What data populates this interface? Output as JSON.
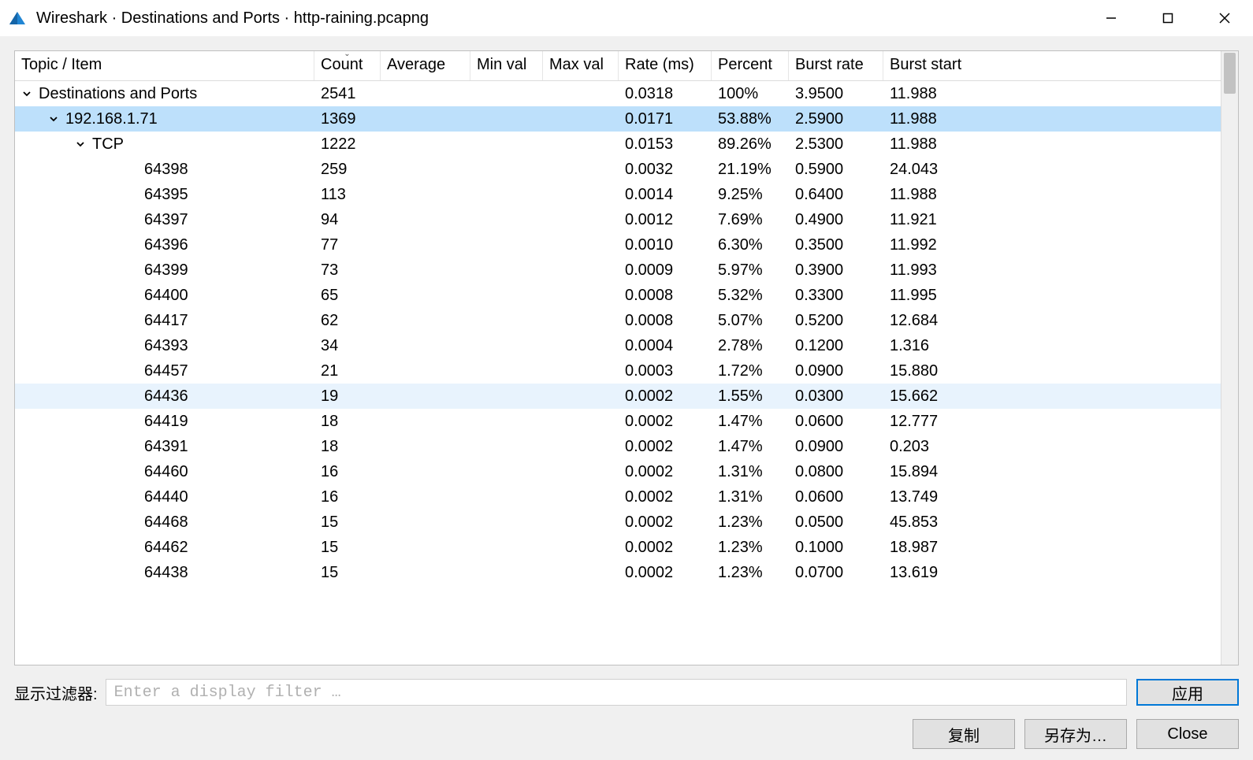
{
  "window": {
    "title": "Wireshark · Destinations and Ports · http-raining.pcapng"
  },
  "columns": {
    "topic": "Topic / Item",
    "count": "Count",
    "average": "Average",
    "minval": "Min val",
    "maxval": "Max val",
    "rate": "Rate (ms)",
    "percent": "Percent",
    "burstrate": "Burst rate",
    "burststart": "Burst start"
  },
  "rows": [
    {
      "indent": 0,
      "expander": "down",
      "label": "Destinations and Ports",
      "count": "2541",
      "avg": "",
      "min": "",
      "max": "",
      "rate": "0.0318",
      "percent": "100%",
      "brate": "3.9500",
      "bstart": "11.988",
      "state": ""
    },
    {
      "indent": 1,
      "expander": "down",
      "label": "192.168.1.71",
      "count": "1369",
      "avg": "",
      "min": "",
      "max": "",
      "rate": "0.0171",
      "percent": "53.88%",
      "brate": "2.5900",
      "bstart": "11.988",
      "state": "selected"
    },
    {
      "indent": 2,
      "expander": "down",
      "label": "TCP",
      "count": "1222",
      "avg": "",
      "min": "",
      "max": "",
      "rate": "0.0153",
      "percent": "89.26%",
      "brate": "2.5300",
      "bstart": "11.988",
      "state": ""
    },
    {
      "indent": 3,
      "expander": "",
      "label": "64398",
      "count": "259",
      "avg": "",
      "min": "",
      "max": "",
      "rate": "0.0032",
      "percent": "21.19%",
      "brate": "0.5900",
      "bstart": "24.043",
      "state": ""
    },
    {
      "indent": 3,
      "expander": "",
      "label": "64395",
      "count": "113",
      "avg": "",
      "min": "",
      "max": "",
      "rate": "0.0014",
      "percent": "9.25%",
      "brate": "0.6400",
      "bstart": "11.988",
      "state": ""
    },
    {
      "indent": 3,
      "expander": "",
      "label": "64397",
      "count": "94",
      "avg": "",
      "min": "",
      "max": "",
      "rate": "0.0012",
      "percent": "7.69%",
      "brate": "0.4900",
      "bstart": "11.921",
      "state": ""
    },
    {
      "indent": 3,
      "expander": "",
      "label": "64396",
      "count": "77",
      "avg": "",
      "min": "",
      "max": "",
      "rate": "0.0010",
      "percent": "6.30%",
      "brate": "0.3500",
      "bstart": "11.992",
      "state": ""
    },
    {
      "indent": 3,
      "expander": "",
      "label": "64399",
      "count": "73",
      "avg": "",
      "min": "",
      "max": "",
      "rate": "0.0009",
      "percent": "5.97%",
      "brate": "0.3900",
      "bstart": "11.993",
      "state": ""
    },
    {
      "indent": 3,
      "expander": "",
      "label": "64400",
      "count": "65",
      "avg": "",
      "min": "",
      "max": "",
      "rate": "0.0008",
      "percent": "5.32%",
      "brate": "0.3300",
      "bstart": "11.995",
      "state": ""
    },
    {
      "indent": 3,
      "expander": "",
      "label": "64417",
      "count": "62",
      "avg": "",
      "min": "",
      "max": "",
      "rate": "0.0008",
      "percent": "5.07%",
      "brate": "0.5200",
      "bstart": "12.684",
      "state": ""
    },
    {
      "indent": 3,
      "expander": "",
      "label": "64393",
      "count": "34",
      "avg": "",
      "min": "",
      "max": "",
      "rate": "0.0004",
      "percent": "2.78%",
      "brate": "0.1200",
      "bstart": "1.316",
      "state": ""
    },
    {
      "indent": 3,
      "expander": "",
      "label": "64457",
      "count": "21",
      "avg": "",
      "min": "",
      "max": "",
      "rate": "0.0003",
      "percent": "1.72%",
      "brate": "0.0900",
      "bstart": "15.880",
      "state": ""
    },
    {
      "indent": 3,
      "expander": "",
      "label": "64436",
      "count": "19",
      "avg": "",
      "min": "",
      "max": "",
      "rate": "0.0002",
      "percent": "1.55%",
      "brate": "0.0300",
      "bstart": "15.662",
      "state": "hover"
    },
    {
      "indent": 3,
      "expander": "",
      "label": "64419",
      "count": "18",
      "avg": "",
      "min": "",
      "max": "",
      "rate": "0.0002",
      "percent": "1.47%",
      "brate": "0.0600",
      "bstart": "12.777",
      "state": ""
    },
    {
      "indent": 3,
      "expander": "",
      "label": "64391",
      "count": "18",
      "avg": "",
      "min": "",
      "max": "",
      "rate": "0.0002",
      "percent": "1.47%",
      "brate": "0.0900",
      "bstart": "0.203",
      "state": ""
    },
    {
      "indent": 3,
      "expander": "",
      "label": "64460",
      "count": "16",
      "avg": "",
      "min": "",
      "max": "",
      "rate": "0.0002",
      "percent": "1.31%",
      "brate": "0.0800",
      "bstart": "15.894",
      "state": ""
    },
    {
      "indent": 3,
      "expander": "",
      "label": "64440",
      "count": "16",
      "avg": "",
      "min": "",
      "max": "",
      "rate": "0.0002",
      "percent": "1.31%",
      "brate": "0.0600",
      "bstart": "13.749",
      "state": ""
    },
    {
      "indent": 3,
      "expander": "",
      "label": "64468",
      "count": "15",
      "avg": "",
      "min": "",
      "max": "",
      "rate": "0.0002",
      "percent": "1.23%",
      "brate": "0.0500",
      "bstart": "45.853",
      "state": ""
    },
    {
      "indent": 3,
      "expander": "",
      "label": "64462",
      "count": "15",
      "avg": "",
      "min": "",
      "max": "",
      "rate": "0.0002",
      "percent": "1.23%",
      "brate": "0.1000",
      "bstart": "18.987",
      "state": ""
    },
    {
      "indent": 3,
      "expander": "",
      "label": "64438",
      "count": "15",
      "avg": "",
      "min": "",
      "max": "",
      "rate": "0.0002",
      "percent": "1.23%",
      "brate": "0.0700",
      "bstart": "13.619",
      "state": ""
    }
  ],
  "filter": {
    "label": "显示过滤器:",
    "placeholder": "Enter a display filter …",
    "apply": "应用"
  },
  "buttons": {
    "copy": "复制",
    "saveas": "另存为…",
    "close": "Close"
  }
}
